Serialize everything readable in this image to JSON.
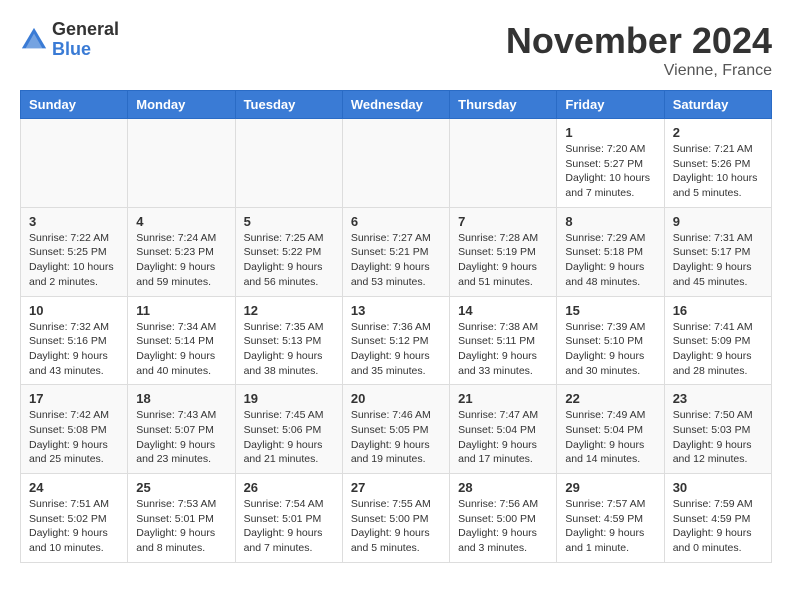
{
  "logo": {
    "general": "General",
    "blue": "Blue"
  },
  "title": "November 2024",
  "subtitle": "Vienne, France",
  "days_of_week": [
    "Sunday",
    "Monday",
    "Tuesday",
    "Wednesday",
    "Thursday",
    "Friday",
    "Saturday"
  ],
  "weeks": [
    [
      {
        "day": "",
        "info": ""
      },
      {
        "day": "",
        "info": ""
      },
      {
        "day": "",
        "info": ""
      },
      {
        "day": "",
        "info": ""
      },
      {
        "day": "",
        "info": ""
      },
      {
        "day": "1",
        "info": "Sunrise: 7:20 AM\nSunset: 5:27 PM\nDaylight: 10 hours and 7 minutes."
      },
      {
        "day": "2",
        "info": "Sunrise: 7:21 AM\nSunset: 5:26 PM\nDaylight: 10 hours and 5 minutes."
      }
    ],
    [
      {
        "day": "3",
        "info": "Sunrise: 7:22 AM\nSunset: 5:25 PM\nDaylight: 10 hours and 2 minutes."
      },
      {
        "day": "4",
        "info": "Sunrise: 7:24 AM\nSunset: 5:23 PM\nDaylight: 9 hours and 59 minutes."
      },
      {
        "day": "5",
        "info": "Sunrise: 7:25 AM\nSunset: 5:22 PM\nDaylight: 9 hours and 56 minutes."
      },
      {
        "day": "6",
        "info": "Sunrise: 7:27 AM\nSunset: 5:21 PM\nDaylight: 9 hours and 53 minutes."
      },
      {
        "day": "7",
        "info": "Sunrise: 7:28 AM\nSunset: 5:19 PM\nDaylight: 9 hours and 51 minutes."
      },
      {
        "day": "8",
        "info": "Sunrise: 7:29 AM\nSunset: 5:18 PM\nDaylight: 9 hours and 48 minutes."
      },
      {
        "day": "9",
        "info": "Sunrise: 7:31 AM\nSunset: 5:17 PM\nDaylight: 9 hours and 45 minutes."
      }
    ],
    [
      {
        "day": "10",
        "info": "Sunrise: 7:32 AM\nSunset: 5:16 PM\nDaylight: 9 hours and 43 minutes."
      },
      {
        "day": "11",
        "info": "Sunrise: 7:34 AM\nSunset: 5:14 PM\nDaylight: 9 hours and 40 minutes."
      },
      {
        "day": "12",
        "info": "Sunrise: 7:35 AM\nSunset: 5:13 PM\nDaylight: 9 hours and 38 minutes."
      },
      {
        "day": "13",
        "info": "Sunrise: 7:36 AM\nSunset: 5:12 PM\nDaylight: 9 hours and 35 minutes."
      },
      {
        "day": "14",
        "info": "Sunrise: 7:38 AM\nSunset: 5:11 PM\nDaylight: 9 hours and 33 minutes."
      },
      {
        "day": "15",
        "info": "Sunrise: 7:39 AM\nSunset: 5:10 PM\nDaylight: 9 hours and 30 minutes."
      },
      {
        "day": "16",
        "info": "Sunrise: 7:41 AM\nSunset: 5:09 PM\nDaylight: 9 hours and 28 minutes."
      }
    ],
    [
      {
        "day": "17",
        "info": "Sunrise: 7:42 AM\nSunset: 5:08 PM\nDaylight: 9 hours and 25 minutes."
      },
      {
        "day": "18",
        "info": "Sunrise: 7:43 AM\nSunset: 5:07 PM\nDaylight: 9 hours and 23 minutes."
      },
      {
        "day": "19",
        "info": "Sunrise: 7:45 AM\nSunset: 5:06 PM\nDaylight: 9 hours and 21 minutes."
      },
      {
        "day": "20",
        "info": "Sunrise: 7:46 AM\nSunset: 5:05 PM\nDaylight: 9 hours and 19 minutes."
      },
      {
        "day": "21",
        "info": "Sunrise: 7:47 AM\nSunset: 5:04 PM\nDaylight: 9 hours and 17 minutes."
      },
      {
        "day": "22",
        "info": "Sunrise: 7:49 AM\nSunset: 5:04 PM\nDaylight: 9 hours and 14 minutes."
      },
      {
        "day": "23",
        "info": "Sunrise: 7:50 AM\nSunset: 5:03 PM\nDaylight: 9 hours and 12 minutes."
      }
    ],
    [
      {
        "day": "24",
        "info": "Sunrise: 7:51 AM\nSunset: 5:02 PM\nDaylight: 9 hours and 10 minutes."
      },
      {
        "day": "25",
        "info": "Sunrise: 7:53 AM\nSunset: 5:01 PM\nDaylight: 9 hours and 8 minutes."
      },
      {
        "day": "26",
        "info": "Sunrise: 7:54 AM\nSunset: 5:01 PM\nDaylight: 9 hours and 7 minutes."
      },
      {
        "day": "27",
        "info": "Sunrise: 7:55 AM\nSunset: 5:00 PM\nDaylight: 9 hours and 5 minutes."
      },
      {
        "day": "28",
        "info": "Sunrise: 7:56 AM\nSunset: 5:00 PM\nDaylight: 9 hours and 3 minutes."
      },
      {
        "day": "29",
        "info": "Sunrise: 7:57 AM\nSunset: 4:59 PM\nDaylight: 9 hours and 1 minute."
      },
      {
        "day": "30",
        "info": "Sunrise: 7:59 AM\nSunset: 4:59 PM\nDaylight: 9 hours and 0 minutes."
      }
    ]
  ]
}
